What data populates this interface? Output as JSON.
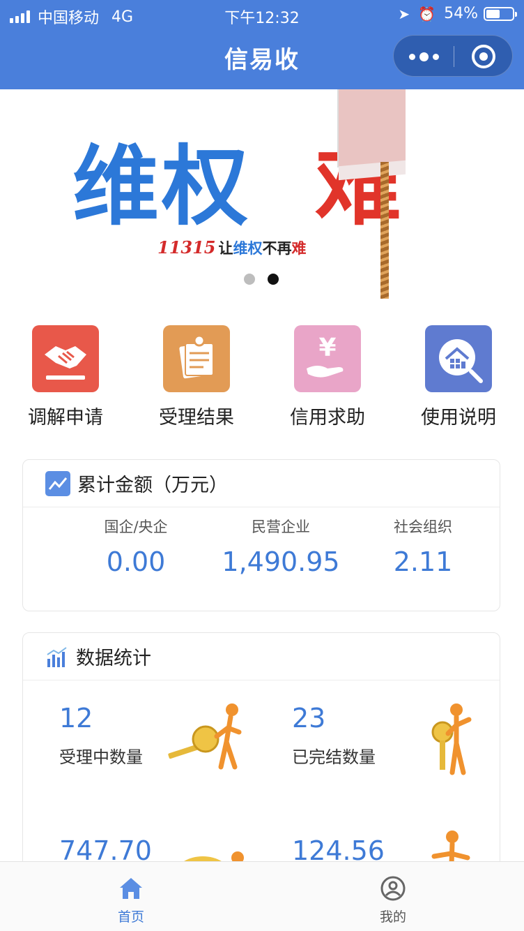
{
  "status_bar": {
    "carrier": "中国移动",
    "network": "4G",
    "time": "下午12:32",
    "battery": "54%",
    "battery_level": 0.54
  },
  "nav": {
    "title": "信易收"
  },
  "banner": {
    "headline_blue": "维权",
    "headline_red": "难",
    "slogan_num": "11315",
    "slogan_1": "让",
    "slogan_2": "维权",
    "slogan_3": "不再",
    "slogan_4": "难",
    "active_slide": 2,
    "slide_count": 2
  },
  "menu": [
    {
      "label": "调解申请",
      "icon": "handshake-icon",
      "color": "#e8584a"
    },
    {
      "label": "受理结果",
      "icon": "document-icon",
      "color": "#e29b55"
    },
    {
      "label": "信用求助",
      "icon": "yuan-hand-icon",
      "color": "#e9a5c8"
    },
    {
      "label": "使用说明",
      "icon": "house-search-icon",
      "color": "#5f7bd0"
    }
  ],
  "amount_card": {
    "title": "累计金额（万元）",
    "items": [
      {
        "label": "国企/央企",
        "value": "0.00"
      },
      {
        "label": "民营企业",
        "value": "1,490.95"
      },
      {
        "label": "社会组织",
        "value": "2.11"
      }
    ]
  },
  "stats_card": {
    "title": "数据统计",
    "items": [
      {
        "value": "12",
        "label": "受理中数量"
      },
      {
        "value": "23",
        "label": "已完结数量"
      },
      {
        "value": "747.70",
        "label": ""
      },
      {
        "value": "124.56",
        "label": ""
      }
    ]
  },
  "tabbar": [
    {
      "label": "首页",
      "icon": "home-icon",
      "active": true
    },
    {
      "label": "我的",
      "icon": "user-icon",
      "active": false
    }
  ],
  "colors": {
    "brand": "#4a7fdb",
    "accent_text": "#3e7ad6"
  }
}
